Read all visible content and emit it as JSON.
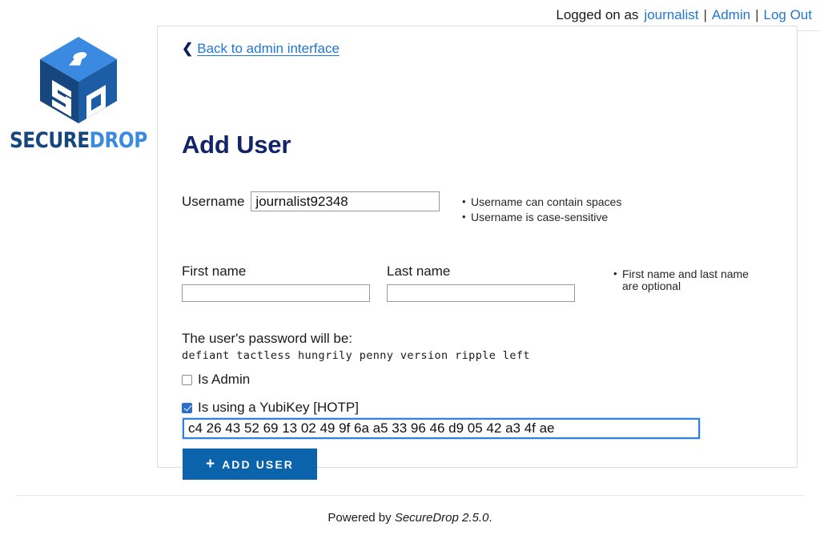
{
  "header": {
    "logged_on_label": "Logged on as",
    "username_link": "journalist",
    "separator": "|",
    "admin_link": "Admin",
    "logout_link": "Log Out"
  },
  "branding": {
    "logo_icon": "securedrop-cube-logo",
    "wordmark_secure": "SECURE",
    "wordmark_drop": "DROP",
    "top_face_color": "#3b8ae2",
    "left_face_color": "#17457e",
    "right_face_color": "#1c5da5"
  },
  "panel": {
    "back_link": {
      "chevron_icon": "chevron-left-icon",
      "label": "Back to admin interface"
    },
    "title": "Add User",
    "form": {
      "username": {
        "label": "Username",
        "value": "journalist92348",
        "placeholder": "",
        "hints": [
          "Username can contain spaces",
          "Username is case-sensitive"
        ]
      },
      "first_name": {
        "label": "First name",
        "value": "",
        "placeholder": ""
      },
      "last_name": {
        "label": "Last name",
        "value": "",
        "placeholder": ""
      },
      "name_hints": [
        "First name and last name are optional"
      ],
      "password": {
        "label": "The user's password will be:",
        "value": "defiant tactless hungrily penny version ripple left"
      },
      "is_admin": {
        "label": "Is Admin",
        "checked": false
      },
      "is_yubikey": {
        "label": "Is using a YubiKey [HOTP]",
        "checked": true
      },
      "otp_secret": {
        "value": "c4 26 43 52 69 13 02 49 9f 6a a5 33 96 46 d9 05 42 a3 4f ae",
        "placeholder": "",
        "focused": true
      },
      "submit": {
        "plus_icon": "plus-icon",
        "label": "ADD USER",
        "color": "#0b63ac"
      }
    }
  },
  "footer": {
    "prefix": "Powered by",
    "product": "SecureDrop 2.5.0",
    "suffix": "."
  }
}
